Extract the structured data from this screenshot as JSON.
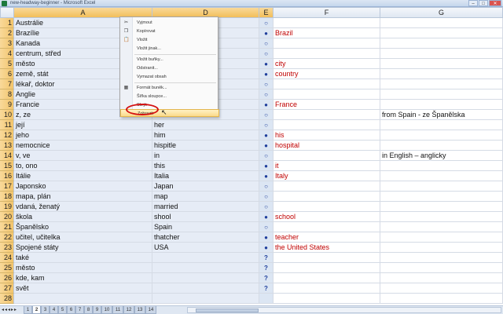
{
  "window": {
    "title": "new-headway-beginner - Microsoft Excel"
  },
  "columns": [
    "A",
    "D",
    "E",
    "F",
    "G"
  ],
  "rows": [
    {
      "n": "1",
      "a": "Austrálie",
      "d": "",
      "e": "○",
      "f": "",
      "g": ""
    },
    {
      "n": "2",
      "a": "Brazílie",
      "d": "",
      "e": "●",
      "f": "Brazil",
      "g": ""
    },
    {
      "n": "3",
      "a": "Kanada",
      "d": "",
      "e": "○",
      "f": "",
      "g": ""
    },
    {
      "n": "4",
      "a": "centrum, střed",
      "d": "",
      "e": "○",
      "f": "",
      "g": ""
    },
    {
      "n": "5",
      "a": "město",
      "d": "",
      "e": "●",
      "f": "city",
      "g": ""
    },
    {
      "n": "6",
      "a": "země, stát",
      "d": "",
      "e": "●",
      "f": "country",
      "g": ""
    },
    {
      "n": "7",
      "a": "lékař, doktor",
      "d": "",
      "e": "○",
      "f": "",
      "g": ""
    },
    {
      "n": "8",
      "a": "Anglie",
      "d": "",
      "e": "○",
      "f": "",
      "g": ""
    },
    {
      "n": "9",
      "a": "Francie",
      "d": "",
      "e": "●",
      "f": "France",
      "g": ""
    },
    {
      "n": "10",
      "a": "z, ze",
      "d": "from",
      "e": "○",
      "f": "",
      "g": "from Spain - ze Španělska"
    },
    {
      "n": "11",
      "a": "její",
      "d": "her",
      "e": "○",
      "f": "",
      "g": ""
    },
    {
      "n": "12",
      "a": "jeho",
      "d": "him",
      "e": "●",
      "f": "his",
      "g": ""
    },
    {
      "n": "13",
      "a": "nemocnice",
      "d": "hispitle",
      "e": "●",
      "f": "hospital",
      "g": ""
    },
    {
      "n": "14",
      "a": "v, ve",
      "d": "in",
      "e": "○",
      "f": "",
      "g": "in English – anglicky"
    },
    {
      "n": "15",
      "a": "to, ono",
      "d": "this",
      "e": "●",
      "f": "it",
      "g": ""
    },
    {
      "n": "16",
      "a": "Itálie",
      "d": "Italia",
      "e": "●",
      "f": "Italy",
      "g": ""
    },
    {
      "n": "17",
      "a": "Japonsko",
      "d": "Japan",
      "e": "○",
      "f": "",
      "g": ""
    },
    {
      "n": "18",
      "a": "mapa, plán",
      "d": "map",
      "e": "○",
      "f": "",
      "g": ""
    },
    {
      "n": "19",
      "a": "vdaná, ženatý",
      "d": "married",
      "e": "○",
      "f": "",
      "g": ""
    },
    {
      "n": "20",
      "a": "škola",
      "d": "shool",
      "e": "●",
      "f": "school",
      "g": ""
    },
    {
      "n": "21",
      "a": "Španělsko",
      "d": "Spain",
      "e": "○",
      "f": "",
      "g": ""
    },
    {
      "n": "22",
      "a": "učitel, učitelka",
      "d": "thatcher",
      "e": "●",
      "f": "teacher",
      "g": ""
    },
    {
      "n": "23",
      "a": "Spojené státy",
      "d": "USA",
      "e": "●",
      "f": "the United States",
      "g": ""
    },
    {
      "n": "24",
      "a": "také",
      "d": "",
      "e": "?",
      "f": "",
      "g": ""
    },
    {
      "n": "25",
      "a": "město",
      "d": "",
      "e": "?",
      "f": "",
      "g": ""
    },
    {
      "n": "26",
      "a": "kde, kam",
      "d": "",
      "e": "?",
      "f": "",
      "g": ""
    },
    {
      "n": "27",
      "a": "svět",
      "d": "",
      "e": "?",
      "f": "",
      "g": ""
    },
    {
      "n": "28",
      "a": "",
      "d": "",
      "e": "",
      "f": "",
      "g": ""
    }
  ],
  "context_menu": {
    "items": [
      {
        "label": "Vyjmout",
        "icon": "✂"
      },
      {
        "label": "Kopírovat",
        "icon": "❐"
      },
      {
        "label": "Vložit",
        "icon": "📋"
      },
      {
        "label": "Vložit jinak...",
        "icon": ""
      },
      {
        "label": "Vložit buňky...",
        "icon": ""
      },
      {
        "label": "Odstranit...",
        "icon": ""
      },
      {
        "label": "Vymazat obsah",
        "icon": ""
      },
      {
        "label": "Formát buněk...",
        "icon": "▦"
      },
      {
        "label": "Šířka sloupce...",
        "icon": ""
      },
      {
        "label": "Skrýt",
        "icon": ""
      },
      {
        "label": "Zobrazit",
        "icon": ""
      }
    ]
  },
  "sheet_tabs": [
    "1",
    "2",
    "3",
    "4",
    "5",
    "6",
    "7",
    "8",
    "9",
    "10",
    "11",
    "12",
    "13",
    "14"
  ],
  "active_tab": "2",
  "colors": {
    "accent_red": "#c00000",
    "marker_blue": "#1f3f9c",
    "selection_orange": "#f2be5a"
  }
}
